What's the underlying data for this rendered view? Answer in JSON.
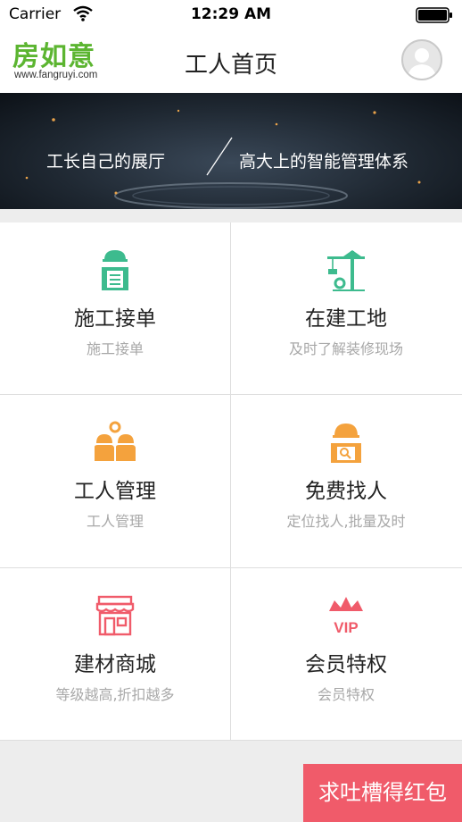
{
  "status_bar": {
    "carrier": "Carrier",
    "time": "12:29 AM"
  },
  "header": {
    "logo_text": "房如意",
    "logo_url": "www.fangruyi.com",
    "title": "工人首页"
  },
  "banner": {
    "left_text": "工长自己的展厅",
    "right_text": "高大上的智能管理体系"
  },
  "menu": [
    {
      "title": "施工接单",
      "subtitle": "施工接单",
      "icon": "worker-clipboard-icon",
      "color": "#3dbb8e"
    },
    {
      "title": "在建工地",
      "subtitle": "及时了解装修现场",
      "icon": "crane-icon",
      "color": "#3dbb8e"
    },
    {
      "title": "工人管理",
      "subtitle": "工人管理",
      "icon": "workers-gear-icon",
      "color": "#f4a23d"
    },
    {
      "title": "免费找人",
      "subtitle": "定位找人,批量及时",
      "icon": "worker-search-icon",
      "color": "#f4a23d"
    },
    {
      "title": "建材商城",
      "subtitle": "等级越高,折扣越多",
      "icon": "store-icon",
      "color": "#f05b6a"
    },
    {
      "title": "会员特权",
      "subtitle": "会员特权",
      "icon": "vip-crown-icon",
      "color": "#f05b6a",
      "icon_text": "VIP"
    }
  ],
  "feedback_button": {
    "label": "求吐槽得红包"
  },
  "colors": {
    "logo_green": "#5cb531",
    "teal": "#3dbb8e",
    "orange": "#f4a23d",
    "pink": "#f05b6a"
  }
}
